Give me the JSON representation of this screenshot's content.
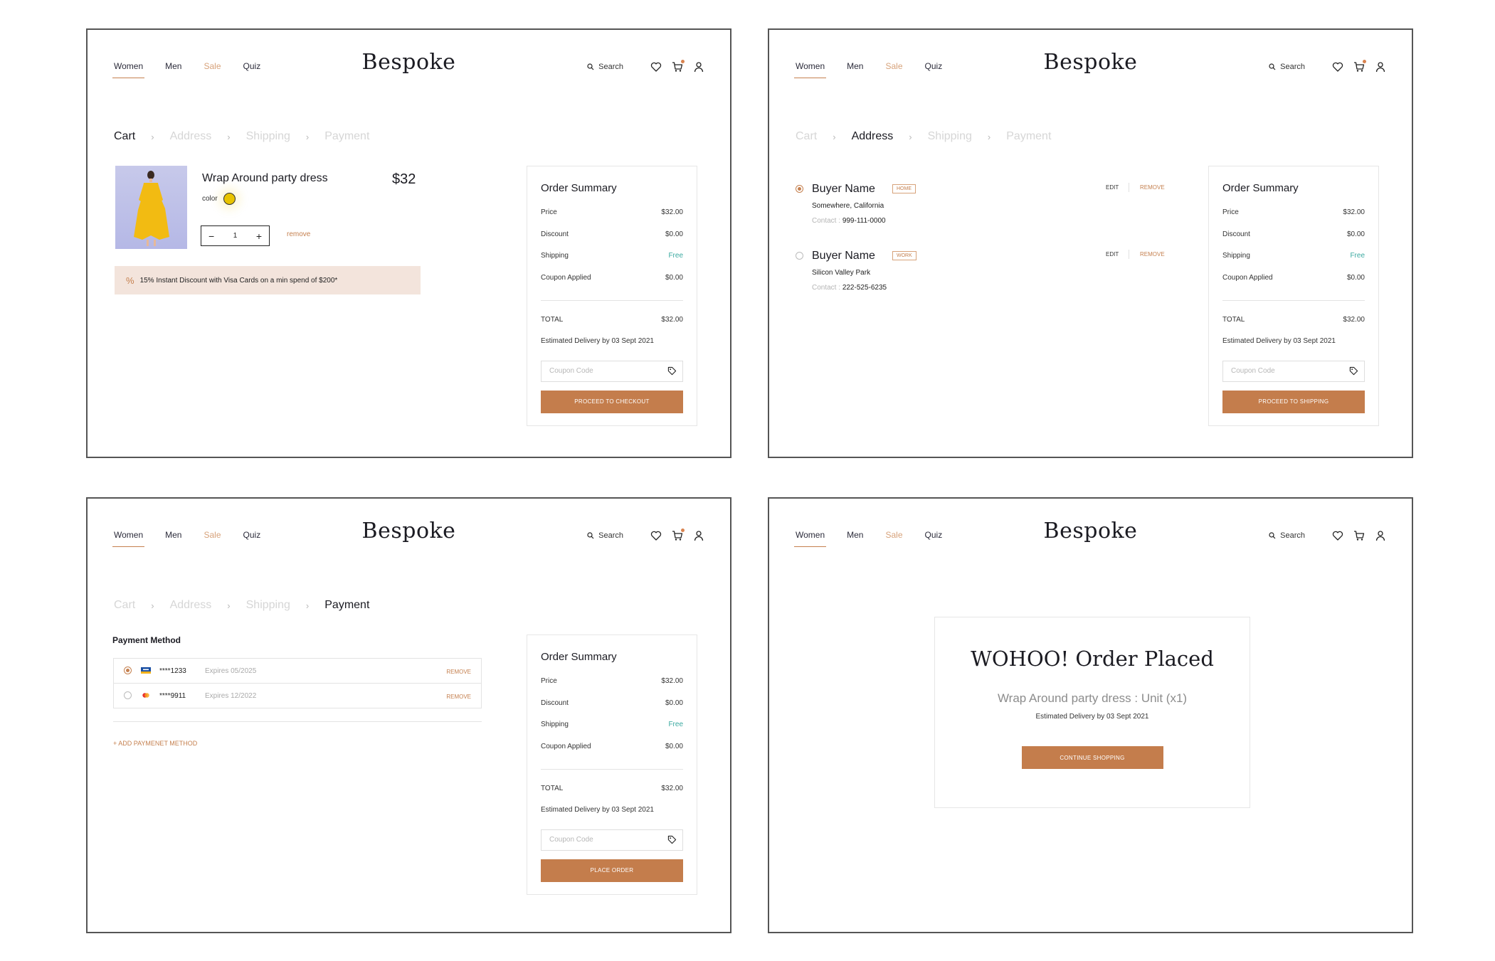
{
  "brand": "Bespoke",
  "nav": [
    "Women",
    "Men",
    "Sale",
    "Quiz"
  ],
  "search_label": "Search",
  "steps": [
    "Cart",
    "Address",
    "Shipping",
    "Payment"
  ],
  "colors": {
    "accent": "#c47d4c",
    "free": "#3aa9a0",
    "promo_bg": "#f3e4dc"
  },
  "cart": {
    "product_title": "Wrap Around party dress",
    "price": "$32",
    "color_label": "color",
    "quantity": "1",
    "remove_label": "remove",
    "promo_text": "15% Instant Discount with Visa Cards on a min spend of $200*",
    "promo_icon": "%"
  },
  "summary": {
    "title": "Order Summary",
    "price_label": "Price",
    "price_value": "$32.00",
    "discount_label": "Discount",
    "discount_value": "$0.00",
    "shipping_label": "Shipping",
    "shipping_value": "Free",
    "coupon_applied_label": "Coupon Applied",
    "coupon_applied_value": "$0.00",
    "total_label": "TOTAL",
    "total_value": "$32.00",
    "estimated": "Estimated Delivery by 03 Sept 2021",
    "coupon_placeholder": "Coupon Code"
  },
  "cta": {
    "cart": "PROCEED TO CHECKOUT",
    "address": "PROCEED TO SHIPPING",
    "payment": "PLACE ORDER",
    "placed": "CONTINUE SHOPPING"
  },
  "addresses": [
    {
      "name": "Buyer Name",
      "tag": "HOME",
      "line1": "Somewhere, California",
      "contact_label": "Contact :",
      "contact": "999-111-0000",
      "edit": "EDIT",
      "remove": "REMOVE",
      "selected": true
    },
    {
      "name": "Buyer Name",
      "tag": "WORK",
      "line1": "Silicon Valley Park",
      "contact_label": "Contact :",
      "contact": "222-525-6235",
      "edit": "EDIT",
      "remove": "REMOVE",
      "selected": false
    }
  ],
  "payment": {
    "title": "Payment Method",
    "cards": [
      {
        "number": "****1233",
        "expires": "Expires 05/2025",
        "remove": "REMOVE",
        "brand": "visa-icon",
        "selected": true
      },
      {
        "number": "****9911",
        "expires": "Expires 12/2022",
        "remove": "REMOVE",
        "brand": "mastercard-icon",
        "selected": false
      }
    ],
    "add_label": "+ ADD PAYMENET METHOD"
  },
  "placed": {
    "heading": "WOHOO!  Order Placed",
    "item": "Wrap Around party dress : Unit (x1)",
    "estimated": "Estimated Delivery by 03 Sept 2021"
  }
}
